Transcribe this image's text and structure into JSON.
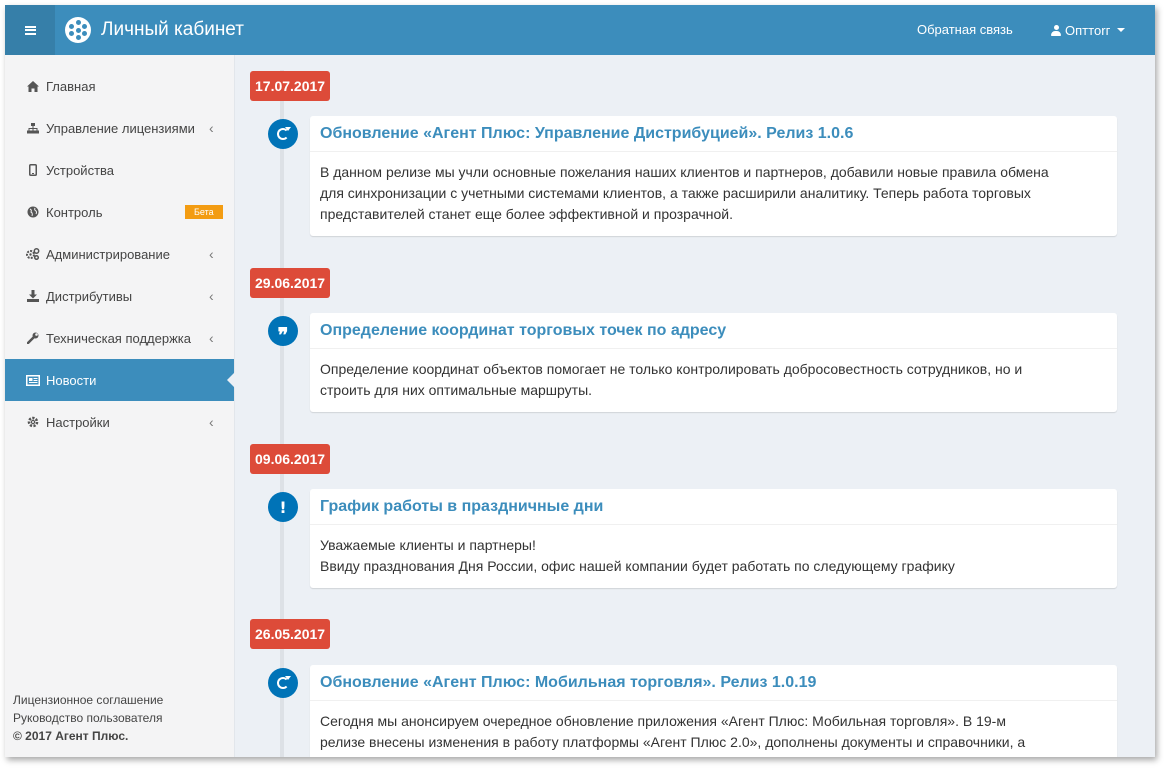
{
  "header": {
    "title": "Личный кабинет",
    "feedback": "Обратная связь",
    "user": "Опттorг"
  },
  "sidebar": {
    "items": [
      {
        "label": "Главная",
        "icon": "home-icon"
      },
      {
        "label": "Управление лицензиями",
        "icon": "sitemap-icon"
      },
      {
        "label": "Устройства",
        "icon": "mobile-icon"
      },
      {
        "label": "Контроль",
        "icon": "globe-icon",
        "badge": "Бета"
      },
      {
        "label": "Администрирование",
        "icon": "cogs-icon"
      },
      {
        "label": "Дистрибутивы",
        "icon": "download-icon"
      },
      {
        "label": "Техническая поддержка",
        "icon": "wrench-icon"
      },
      {
        "label": "Новости",
        "icon": "newspaper-icon",
        "active": true
      },
      {
        "label": "Настройки",
        "icon": "gear-icon"
      }
    ],
    "footer": {
      "license": "Лицензионное соглашение",
      "manual": "Руководство пользователя",
      "copyright": "© 2017 Агент Плюс."
    }
  },
  "timeline": [
    {
      "date": "17.07.2017",
      "icon": "refresh-icon",
      "title": "Обновление «Агент Плюс: Управление Дистрибуцией». Релиз 1.0.6",
      "lines": [
        "В данном релизе мы учли основные пожелания наших клиентов и партнеров, добавили новые правила обмена",
        "для синхронизации с учетными системами клиентов, а также расширили аналитику. Теперь работа торговых",
        "представителей станет еще более эффективной и прозрачной."
      ]
    },
    {
      "date": "29.06.2017",
      "icon": "quote-icon",
      "title": "Определение координат торговых точек по адресу",
      "lines": [
        "Определение координат объектов помогает не только контролировать добросовестность сотрудников, но и",
        "строить для них оптимальные маршруты."
      ]
    },
    {
      "date": "09.06.2017",
      "icon": "exclamation-icon",
      "title": "График работы в праздничные дни",
      "lines": [
        "Уважаемые клиенты и партнеры!",
        "Ввиду празднования Дня России, офис нашей компании будет работать по следующему графику"
      ]
    },
    {
      "date": "26.05.2017",
      "icon": "refresh-icon",
      "title": "Обновление «Агент Плюс: Мобильная торговля». Релиз 1.0.19",
      "lines": [
        "Сегодня мы анонсируем очередное обновление приложения «Агент Плюс: Мобильная торговля». В 19-м",
        "релизе внесены изменения в работу платформы «Агент Плюс 2.0», дополнены документы и справочники, а"
      ]
    }
  ],
  "colors": {
    "primary": "#3c8dbc",
    "date_label": "#dd4b39",
    "timeline_icon": "#0073b7",
    "badge": "#f39c12"
  }
}
